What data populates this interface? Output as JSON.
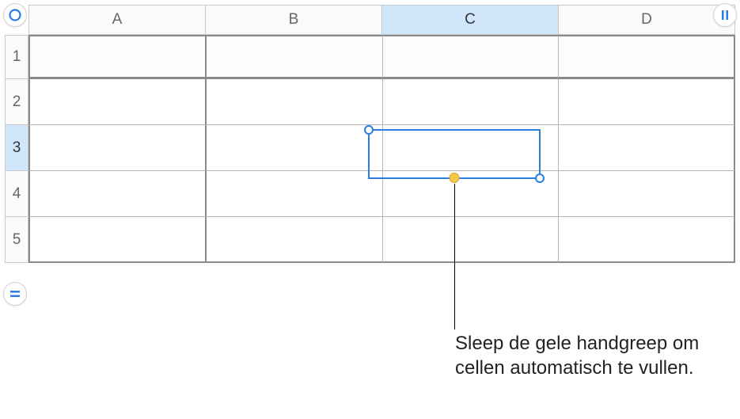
{
  "columns": [
    "A",
    "B",
    "C",
    "D"
  ],
  "rows": [
    "1",
    "2",
    "3",
    "4",
    "5"
  ],
  "selected_column_index": 2,
  "selected_row_index": 2,
  "selected_cell": "C3",
  "callout": {
    "text": "Sleep de gele handgreep om cellen automatisch te vullen."
  },
  "icons": {
    "select_all": "circle",
    "add_column": "bars-vertical",
    "add_row": "bars-horizontal"
  },
  "colors": {
    "selection_border": "#2a7de1",
    "header_selected": "#cfe6fb",
    "autofill_handle": "#f5c84b"
  }
}
